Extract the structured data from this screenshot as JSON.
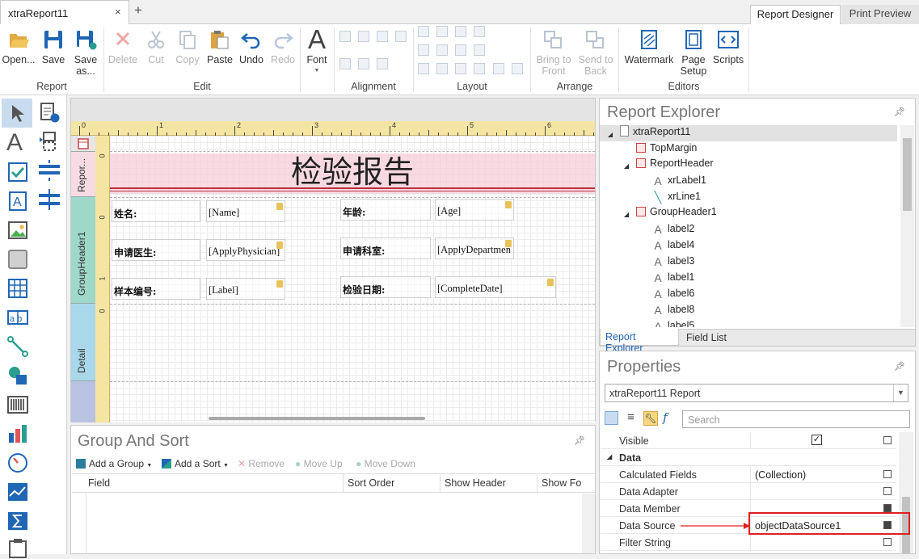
{
  "tabs": {
    "document": "xtraReport11",
    "close": "×",
    "new": "+",
    "designer": "Report Designer",
    "preview": "Print Preview"
  },
  "ribbon": {
    "report": {
      "group": "Report",
      "open": "Open...",
      "save": "Save",
      "save_as": "Save as..."
    },
    "edit": {
      "group": "Edit",
      "delete": "Delete",
      "cut": "Cut",
      "copy": "Copy",
      "paste": "Paste",
      "undo": "Undo",
      "redo": "Redo"
    },
    "font": {
      "label": "Font"
    },
    "alignment": {
      "group": "Alignment"
    },
    "layout": {
      "group": "Layout"
    },
    "arrange": {
      "group": "Arrange",
      "bring_front": "Bring to Front",
      "send_back": "Send to Back"
    },
    "editors": {
      "group": "Editors",
      "watermark": "Watermark",
      "page_setup": "Page Setup",
      "scripts": "Scripts"
    }
  },
  "ruler_numbers": [
    "0",
    "1",
    "2",
    "3",
    "4",
    "5",
    "6"
  ],
  "bands": {
    "report_header": "Repor...",
    "group_header": "GroupHeader1",
    "detail": "Detail"
  },
  "report": {
    "title": "检验报告",
    "labels": {
      "name": "姓名:",
      "age": "年龄:",
      "physician": "申请医生:",
      "department": "申请科室:",
      "sample": "样本编号:",
      "date": "检验日期:"
    },
    "fields": {
      "name": "[Name]",
      "age": "[Age]",
      "physician": "[ApplyPhysician]",
      "department": "[ApplyDepartmen",
      "sample": "[Label]",
      "date": "[CompleteDate]"
    }
  },
  "group_sort": {
    "title": "Group And Sort",
    "add_group": "Add a Group",
    "add_sort": "Add a Sort",
    "remove": "Remove",
    "move_up": "Move Up",
    "move_down": "Move Down",
    "columns": [
      "Field",
      "Sort Order",
      "Show Header",
      "Show Fo"
    ]
  },
  "report_explorer": {
    "title": "Report Explorer",
    "tree": [
      {
        "label": "xtraReport11",
        "icon": "report-icon"
      },
      {
        "label": "TopMargin",
        "icon": "band-icon"
      },
      {
        "label": "ReportHeader",
        "icon": "band-icon"
      },
      {
        "label": "xrLabel1",
        "icon": "label-icon"
      },
      {
        "label": "xrLine1",
        "icon": "line-icon"
      },
      {
        "label": "GroupHeader1",
        "icon": "band-icon"
      },
      {
        "label": "label2",
        "icon": "label-icon"
      },
      {
        "label": "label4",
        "icon": "label-icon"
      },
      {
        "label": "label3",
        "icon": "label-icon"
      },
      {
        "label": "label1",
        "icon": "label-icon"
      },
      {
        "label": "label6",
        "icon": "label-icon"
      },
      {
        "label": "label8",
        "icon": "label-icon"
      },
      {
        "label": "label5",
        "icon": "label-icon"
      }
    ],
    "tab_explorer": "Report Explorer",
    "tab_fieldlist": "Field List"
  },
  "properties": {
    "title": "Properties",
    "selector": "xtraReport11  Report",
    "search_placeholder": "Search",
    "visible": {
      "name": "Visible",
      "checked": true
    },
    "section": "Data",
    "rows": [
      {
        "name": "Calculated Fields",
        "value": "(Collection)"
      },
      {
        "name": "Data Adapter",
        "value": ""
      },
      {
        "name": "Data Member",
        "value": ""
      },
      {
        "name": "Data Source",
        "value": "objectDataSource1"
      },
      {
        "name": "Filter String",
        "value": ""
      }
    ]
  },
  "colors": {
    "highlight": "#e02020",
    "accent": "#1e62b0",
    "header_band": "#f7dbe2",
    "group_band": "#9ed8c9",
    "detail_band": "#a9d8ea",
    "ruler": "#f5e5a3"
  }
}
